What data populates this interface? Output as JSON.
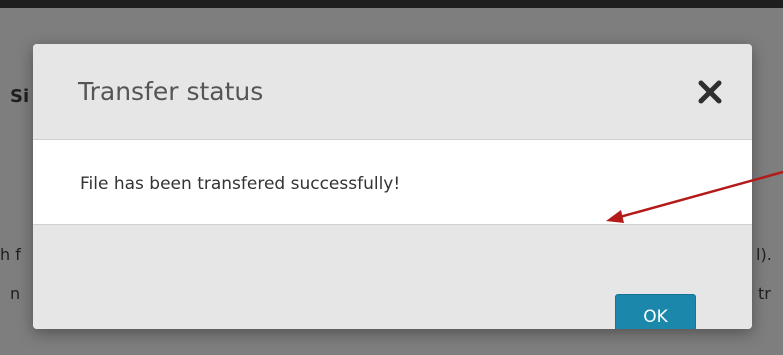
{
  "background": {
    "fragments": [
      {
        "id": "heading",
        "text": "Si"
      },
      {
        "id": "left-line1",
        "text": "h f"
      },
      {
        "id": "left-line2",
        "text": "n"
      },
      {
        "id": "right-line1",
        "text": "l)."
      },
      {
        "id": "right-line2",
        "text": "tr"
      }
    ]
  },
  "dialog": {
    "title": "Transfer status",
    "close_icon": "close-icon",
    "message": "File has been transfered successfully!",
    "ok_label": "OK"
  },
  "annotation": {
    "type": "arrow",
    "color": "#b41a1a"
  },
  "colors": {
    "overlay": "#7e7e7e",
    "topbar": "#1e1e1e",
    "dialog_header": "#e6e6e6",
    "dialog_body": "#ffffff",
    "button": "#1a87ab",
    "button_text": "#ffffff",
    "title_text": "#555555",
    "arrow": "#b41a1a"
  }
}
